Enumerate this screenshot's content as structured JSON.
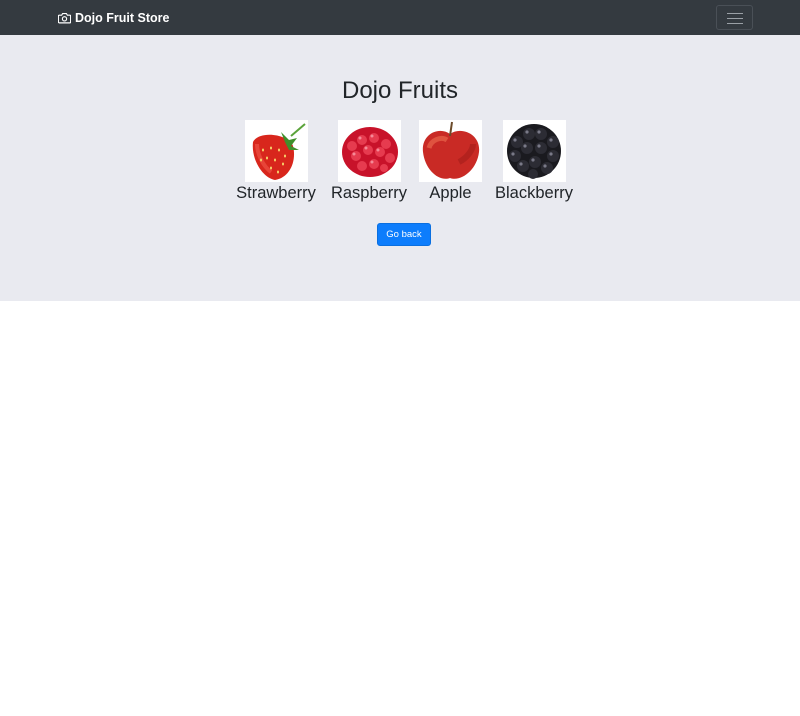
{
  "navbar": {
    "brand_label": "Dojo Fruit Store",
    "brand_icon": "camera-icon",
    "toggler_icon": "hamburger-icon",
    "background": "#343a40"
  },
  "main": {
    "title": "Dojo Fruits",
    "background": "#e9eaf0",
    "fruits": [
      {
        "name": "Strawberry",
        "image": "strawberry"
      },
      {
        "name": "Raspberry",
        "image": "raspberry"
      },
      {
        "name": "Apple",
        "image": "apple"
      },
      {
        "name": "Blackberry",
        "image": "blackberry"
      }
    ],
    "back_button_label": "Go back",
    "accent_color": "#0d7dfc"
  }
}
